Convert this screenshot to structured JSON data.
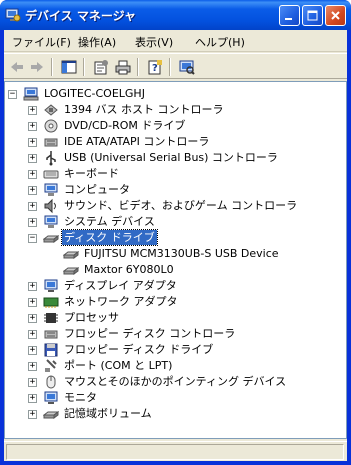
{
  "window": {
    "title": "デバイス マネージャ"
  },
  "menu": [
    "ファイル(F)",
    "操作(A)",
    "表示(V)",
    "ヘルプ(H)"
  ],
  "tree": {
    "root": "LOGITEC-COELGHJ",
    "items": [
      "1394 バス ホスト コントローラ",
      "DVD/CD-ROM ドライブ",
      "IDE ATA/ATAPI コントローラ",
      "USB (Universal Serial Bus) コントローラ",
      "キーボード",
      "コンピュータ",
      "サウンド、ビデオ、およびゲーム コントローラ",
      "システム デバイス",
      "ディスク ドライブ",
      "FUJITSU MCM3130UB-S USB Device",
      "Maxtor 6Y080L0",
      "ディスプレイ アダプタ",
      "ネットワーク アダプタ",
      "プロセッサ",
      "フロッピー ディスク コントローラ",
      "フロッピー ディスク ドライブ",
      "ポート (COM と LPT)",
      "マウスとそのほかのポインティング デバイス",
      "モニタ",
      "記憶域ボリューム"
    ]
  },
  "colors": {
    "selection": "#316ac5",
    "titlebar": "#0a5ce8",
    "face": "#ece9d8"
  }
}
